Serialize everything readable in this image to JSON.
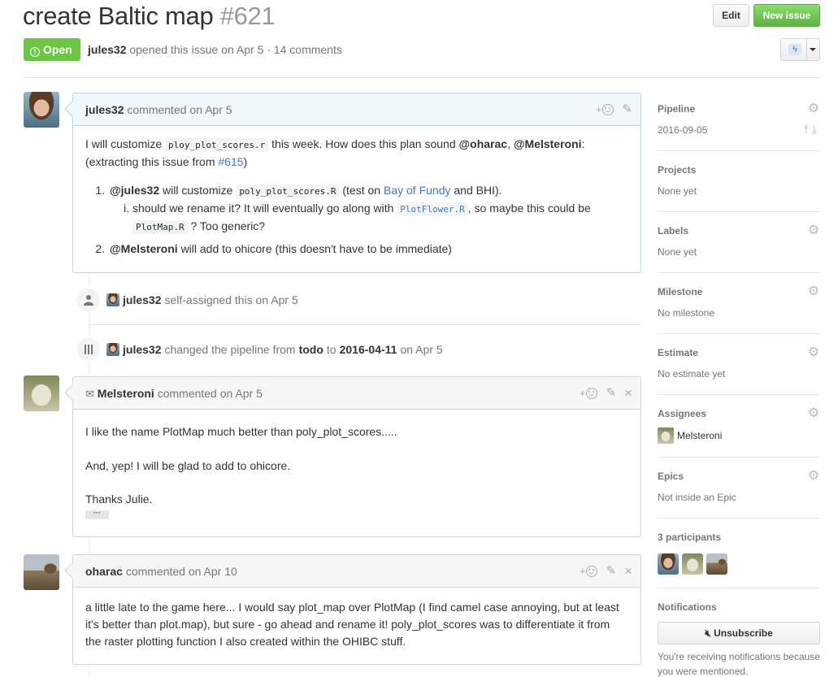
{
  "issue": {
    "title": "create Baltic map",
    "number": "#621",
    "state": "Open",
    "author": "jules32",
    "meta_text": "opened this issue on Apr 5 · 14 comments"
  },
  "header": {
    "edit_label": "Edit",
    "new_issue_label": "New issue"
  },
  "comments": [
    {
      "author": "jules32",
      "action": "commented on Apr 5",
      "p1_pre": "I will customize",
      "p1_code": "ploy_plot_scores.r",
      "p1_mid": "this week. How does this plan sound",
      "p1_m1": "@oharac",
      "p1_comma": ",",
      "p1_m2": "@Melsteroni",
      "p1_post": ":",
      "p1_line2_pre": "(extracting this issue from",
      "p1_link": "#615",
      "p1_line2_post": ")",
      "li1_m": "@jules32",
      "li1_t1": "will customize",
      "li1_code": "poly_plot_scores.R",
      "li1_t2": "(test on",
      "li1_link": "Bay of Fundy",
      "li1_t3": "and BHI).",
      "li1_sub_t1": "should we rename it? It will eventually go along with",
      "li1_sub_code1": "PlotFlower.R",
      "li1_sub_t2": ", so maybe this could be",
      "li1_sub_code2": "PlotMap.R",
      "li1_sub_t3": "? Too generic?",
      "li2_m": "@Melsteroni",
      "li2_t": "will add to ohicore (this doesn't have to be immediate)"
    },
    {
      "author": "Melsteroni",
      "action": "commented on Apr 5",
      "p1": "I like the name PlotMap much better than poly_plot_scores.....",
      "p2": "And, yep!  I will be glad to add to ohicore.",
      "p3": "Thanks Julie.",
      "ellipsis": "···"
    },
    {
      "author": "oharac",
      "action": "commented on Apr 10",
      "p1": "a little late to the game here... I would say plot_map over PlotMap (I find camel case annoying, but at least it's better than plot.map), but sure - go ahead and rename it! poly_plot_scores was to differentiate it from the raster plotting function I also created within the OHIBC stuff."
    }
  ],
  "events": [
    {
      "actor": "jules32",
      "text": "self-assigned this on Apr 5"
    },
    {
      "actor": "jules32",
      "t1": "changed the pipeline from",
      "from": "todo",
      "t2": "to",
      "to": "2016-04-11",
      "t3": "on Apr 5"
    }
  ],
  "sidebar": {
    "pipeline_title": "Pipeline",
    "pipeline_value": "2016-09-05",
    "projects_title": "Projects",
    "projects_value": "None yet",
    "labels_title": "Labels",
    "labels_value": "None yet",
    "milestone_title": "Milestone",
    "milestone_value": "No milestone",
    "estimate_title": "Estimate",
    "estimate_value": "No estimate yet",
    "assignees_title": "Assignees",
    "assignee_name": "Melsteroni",
    "epics_title": "Epics",
    "epics_value": "Not inside an Epic",
    "participants_title": "3 participants",
    "notifications_title": "Notifications",
    "unsubscribe_label": "Unsubscribe",
    "notif_reason": "You're receiving notifications because you were mentioned."
  },
  "colors": {
    "open_green": "#6cc644",
    "link_blue": "#4078c0",
    "new_issue_green": "#60b044"
  }
}
